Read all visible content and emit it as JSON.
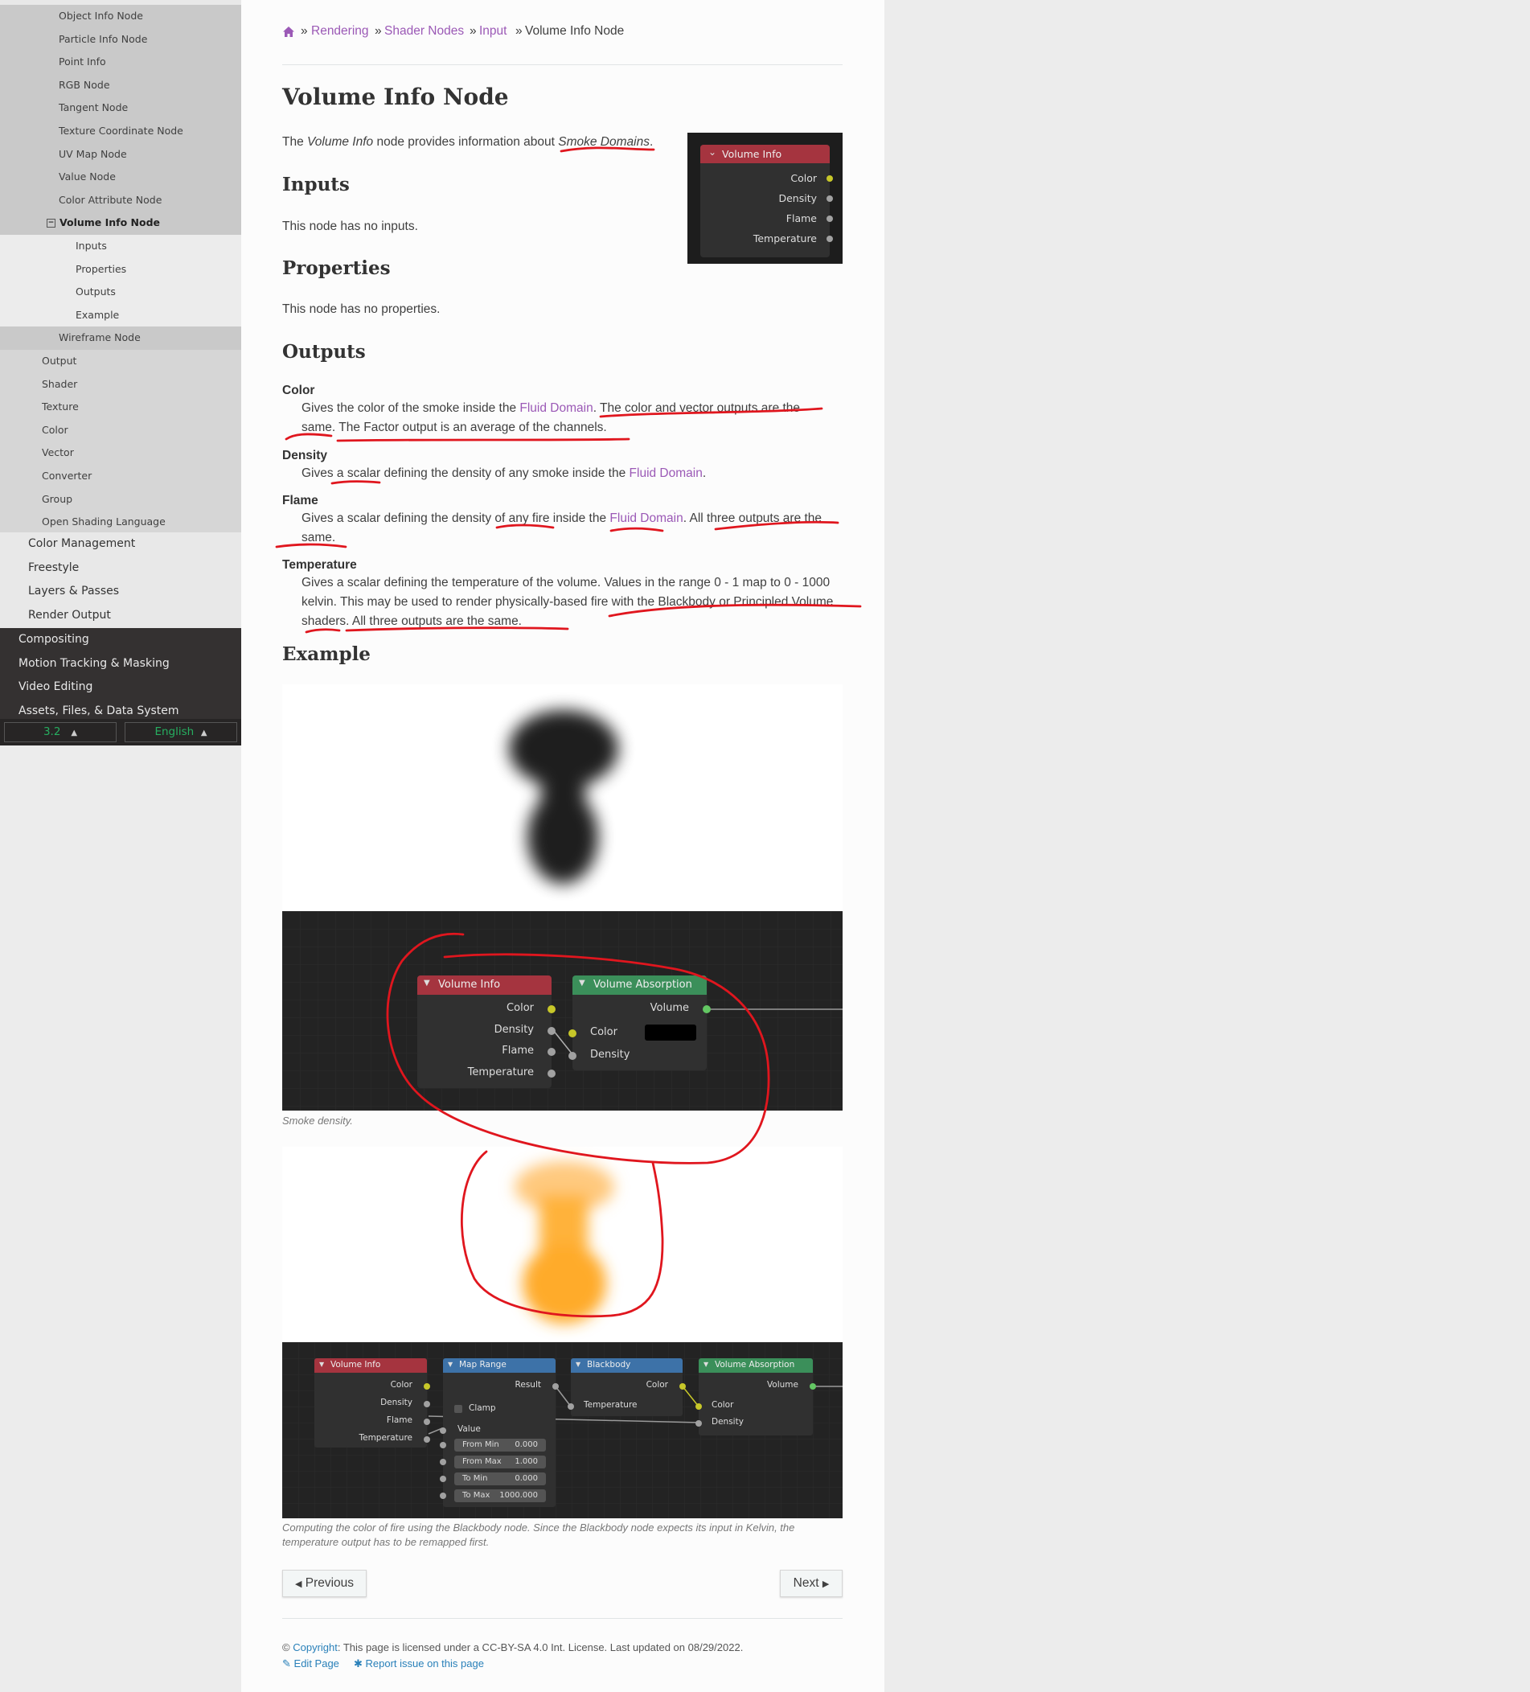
{
  "sidebar": {
    "items_level4": [
      "Object Info Node",
      "Particle Info Node",
      "Point Info",
      "RGB Node",
      "Tangent Node",
      "Texture Coordinate Node",
      "UV Map Node",
      "Value Node",
      "Color Attribute Node"
    ],
    "current": "Volume Info Node",
    "collapse_glyph": "−",
    "sub_items": [
      "Inputs",
      "Properties",
      "Outputs",
      "Example"
    ],
    "wireframe": "Wireframe Node",
    "items_level3": [
      "Output",
      "Shader",
      "Texture",
      "Color",
      "Vector",
      "Converter",
      "Group",
      "Open Shading Language"
    ],
    "items_level2": [
      "Color Management",
      "Freestyle",
      "Layers & Passes",
      "Render Output"
    ],
    "items_level1": [
      "Compositing",
      "Motion Tracking & Masking",
      "Video Editing",
      "Assets, Files, & Data System"
    ],
    "version": "3.2",
    "language": "English",
    "caret": "▲"
  },
  "breadcrumb": {
    "home_icon": "home-icon",
    "sep": "»",
    "items": [
      "Rendering",
      "Shader Nodes",
      "Input"
    ],
    "current": "Volume Info Node"
  },
  "page": {
    "title": "Volume Info Node",
    "intro_pre": "The ",
    "intro_em": "Volume Info",
    "intro_mid": " node provides information about ",
    "intro_em2": "Smoke Domains",
    "intro_post": ".",
    "inputs_heading": "Inputs",
    "inputs_text": "This node has no inputs.",
    "properties_heading": "Properties",
    "properties_text": "This node has no properties.",
    "outputs_heading": "Outputs",
    "example_heading": "Example"
  },
  "outputs": {
    "color_term": "Color",
    "color_l1_pre": "Gives the color of the smoke inside the ",
    "color_l1_link": "Fluid Domain",
    "color_l1_post": ". The color and vector outputs are the",
    "color_l2": "same. The Factor output is an average of the channels.",
    "density_term": "Density",
    "density_pre": "Gives a scalar defining the density of any smoke inside the ",
    "density_link": "Fluid Domain",
    "density_post": ".",
    "flame_term": "Flame",
    "flame_l1_pre": "Gives a scalar defining the density of any fire inside the ",
    "flame_l1_link": "Fluid Domain",
    "flame_l1_post": ". All three outputs are the",
    "flame_l2": "same.",
    "temp_term": "Temperature",
    "temp_l1": "Gives a scalar defining the temperature of the volume. Values in the range 0 - 1 map to 0 - 1000",
    "temp_l2": "kelvin. This may be used to render physically-based fire with the Blackbody or Principled Volume",
    "temp_l3": "shaders. All three outputs are the same."
  },
  "node_thumb": {
    "title": "Volume Info",
    "sockets": [
      "Color",
      "Density",
      "Flame",
      "Temperature"
    ]
  },
  "fig1": {
    "vi_title": "Volume Info",
    "vi_sockets": [
      "Color",
      "Density",
      "Flame",
      "Temperature"
    ],
    "va_title": "Volume Absorption",
    "va_out": "Volume",
    "va_in": [
      "Color",
      "Density"
    ],
    "caption": "Smoke density."
  },
  "fig2": {
    "vi_title": "Volume Info",
    "vi_sockets": [
      "Color",
      "Density",
      "Flame",
      "Temperature"
    ],
    "mr_title": "Map Range",
    "mr_out": "Result",
    "mr_clamp": "Clamp",
    "mr_value": "Value",
    "mr_fields": [
      {
        "label": "From Min",
        "value": "0.000"
      },
      {
        "label": "From Max",
        "value": "1.000"
      },
      {
        "label": "To Min",
        "value": "0.000"
      },
      {
        "label": "To Max",
        "value": "1000.000"
      }
    ],
    "bb_title": "Blackbody",
    "bb_out": "Color",
    "bb_in": "Temperature",
    "va_title": "Volume Absorption",
    "va_out": "Volume",
    "va_in": [
      "Color",
      "Density"
    ],
    "caption_l1": "Computing the color of fire using the Blackbody node. Since the Blackbody node expects its input in Kelvin, the",
    "caption_l2": "temperature output has to be remapped first."
  },
  "nav_buttons": {
    "previous": "Previous",
    "next": "Next",
    "prev_icon": "◀",
    "next_icon": "▶"
  },
  "footer": {
    "copyright_sym": "©",
    "copyright_link": "Copyright",
    "license": ": This page is licensed under a CC-BY-SA 4.0 Int. License. Last updated on 08/29/2022.",
    "edit": "Edit Page",
    "report": "Report issue on this page"
  },
  "colors": {
    "link": "#9b59b6",
    "annotation": "#e0161e",
    "node_red": "#a5343f",
    "node_green": "#3b8f5a",
    "node_blue": "#3d72a8",
    "socket_yellow": "#c7c729",
    "socket_grey": "#a1a1a1",
    "socket_green": "#63c763"
  }
}
